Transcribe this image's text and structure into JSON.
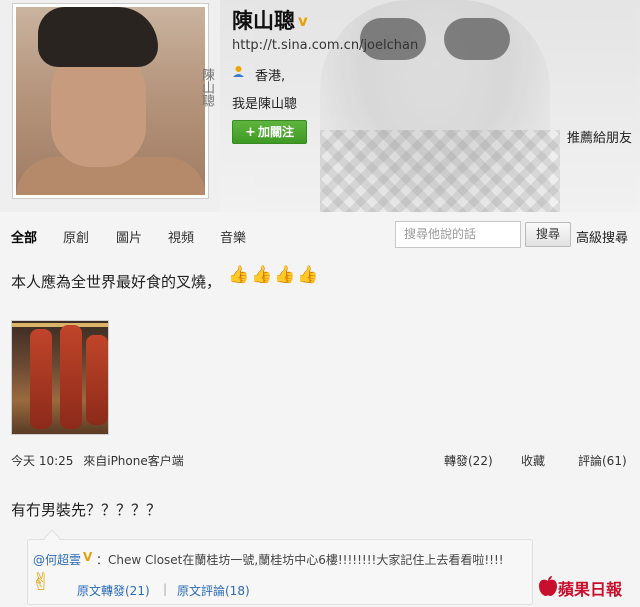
{
  "profile": {
    "name": "陳山聰",
    "verified_mark": "v",
    "avatar_signature": "陳山聰",
    "url": "http://t.sina.com.cn/joelchan",
    "location": "香港,",
    "bio": "我是陳山聰",
    "follow_label": "加關注",
    "recommend_label": "推薦給朋友"
  },
  "tabs": [
    "全部",
    "原創",
    "圖片",
    "視頻",
    "音樂"
  ],
  "search": {
    "placeholder": "搜尋他說的話",
    "button_label": "搜尋",
    "advanced_label": "高級搜尋"
  },
  "post1": {
    "text": "本人應為全世界最好食的叉燒，",
    "emoji_icons": [
      "thumbs-up-icon",
      "thumbs-up-icon",
      "thumbs-up-icon",
      "thumbs-up-icon"
    ],
    "time": "今天 10:25",
    "source": "來自iPhone客户端",
    "forward_label": "轉發(22)",
    "favorite_label": "收藏",
    "comment_label": "評論(61)"
  },
  "post2": {
    "text": "有冇男裝先？？？？？",
    "repost": {
      "author": "@何超雲",
      "verified_mark": "V",
      "text": "：Chew Closet在蘭桂坊一號,蘭桂坊中心6樓!!!!!!!!大家記住上去看看啦!!!!",
      "icon": "victory-hand-icon",
      "forward_label": "原文轉發(21)",
      "separator": "|",
      "comment_label": "原文評論(18)"
    }
  },
  "watermark": {
    "text": "蘋果日報",
    "icon": "apple-logo-icon",
    "color": "#c8102e"
  },
  "colors": {
    "follow_button": "#4ea632",
    "link": "#2b6bb8",
    "verified": "#e3a10c"
  }
}
